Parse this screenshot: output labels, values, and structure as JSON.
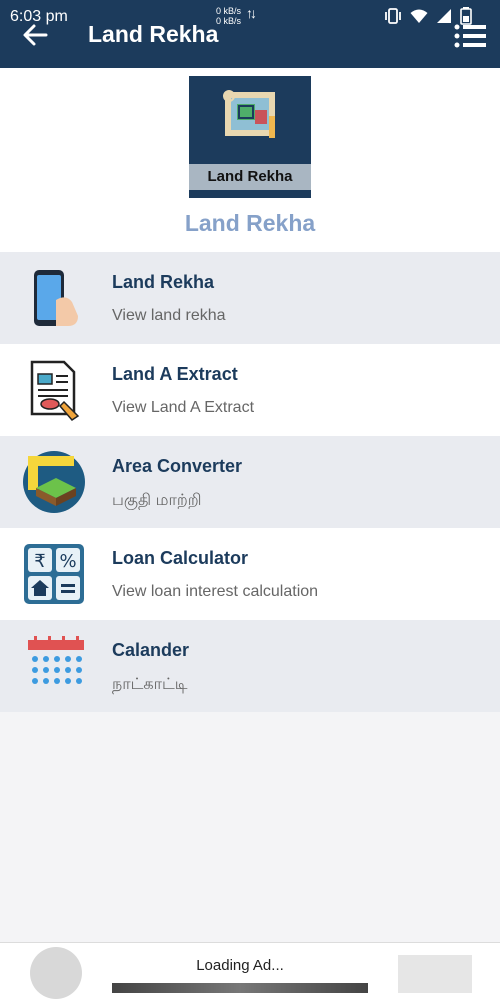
{
  "status_bar": {
    "time": "6:03 pm",
    "net_up": "0 kB/s",
    "net_down": "0 kB/s"
  },
  "appbar": {
    "title": "Land Rekha",
    "icons": [
      "back-arrow-icon",
      "menu-list-icon"
    ]
  },
  "header": {
    "logo_label": "Land Rekha",
    "app_name": "Land Rekha"
  },
  "menu": [
    {
      "title": "Land Rekha",
      "subtitle": "View land rekha",
      "icon": "phone-hand-icon"
    },
    {
      "title": "Land A Extract",
      "subtitle": "View Land A Extract",
      "icon": "document-extract-icon"
    },
    {
      "title": "Area Converter",
      "subtitle": "பகுதி மாற்றி",
      "icon": "area-land-icon"
    },
    {
      "title": "Loan Calculator",
      "subtitle": "View loan interest calculation",
      "icon": "calculator-icon"
    },
    {
      "title": "Calander",
      "subtitle": "நாட்காட்டி",
      "icon": "calendar-icon"
    }
  ],
  "ad": {
    "loading_text": "Loading Ad..."
  },
  "colors": {
    "appbar": "#1c3b5c",
    "accent_text": "#86a1c9",
    "item_title": "#1c3b5c",
    "shaded_row": "#e9ebf0"
  }
}
